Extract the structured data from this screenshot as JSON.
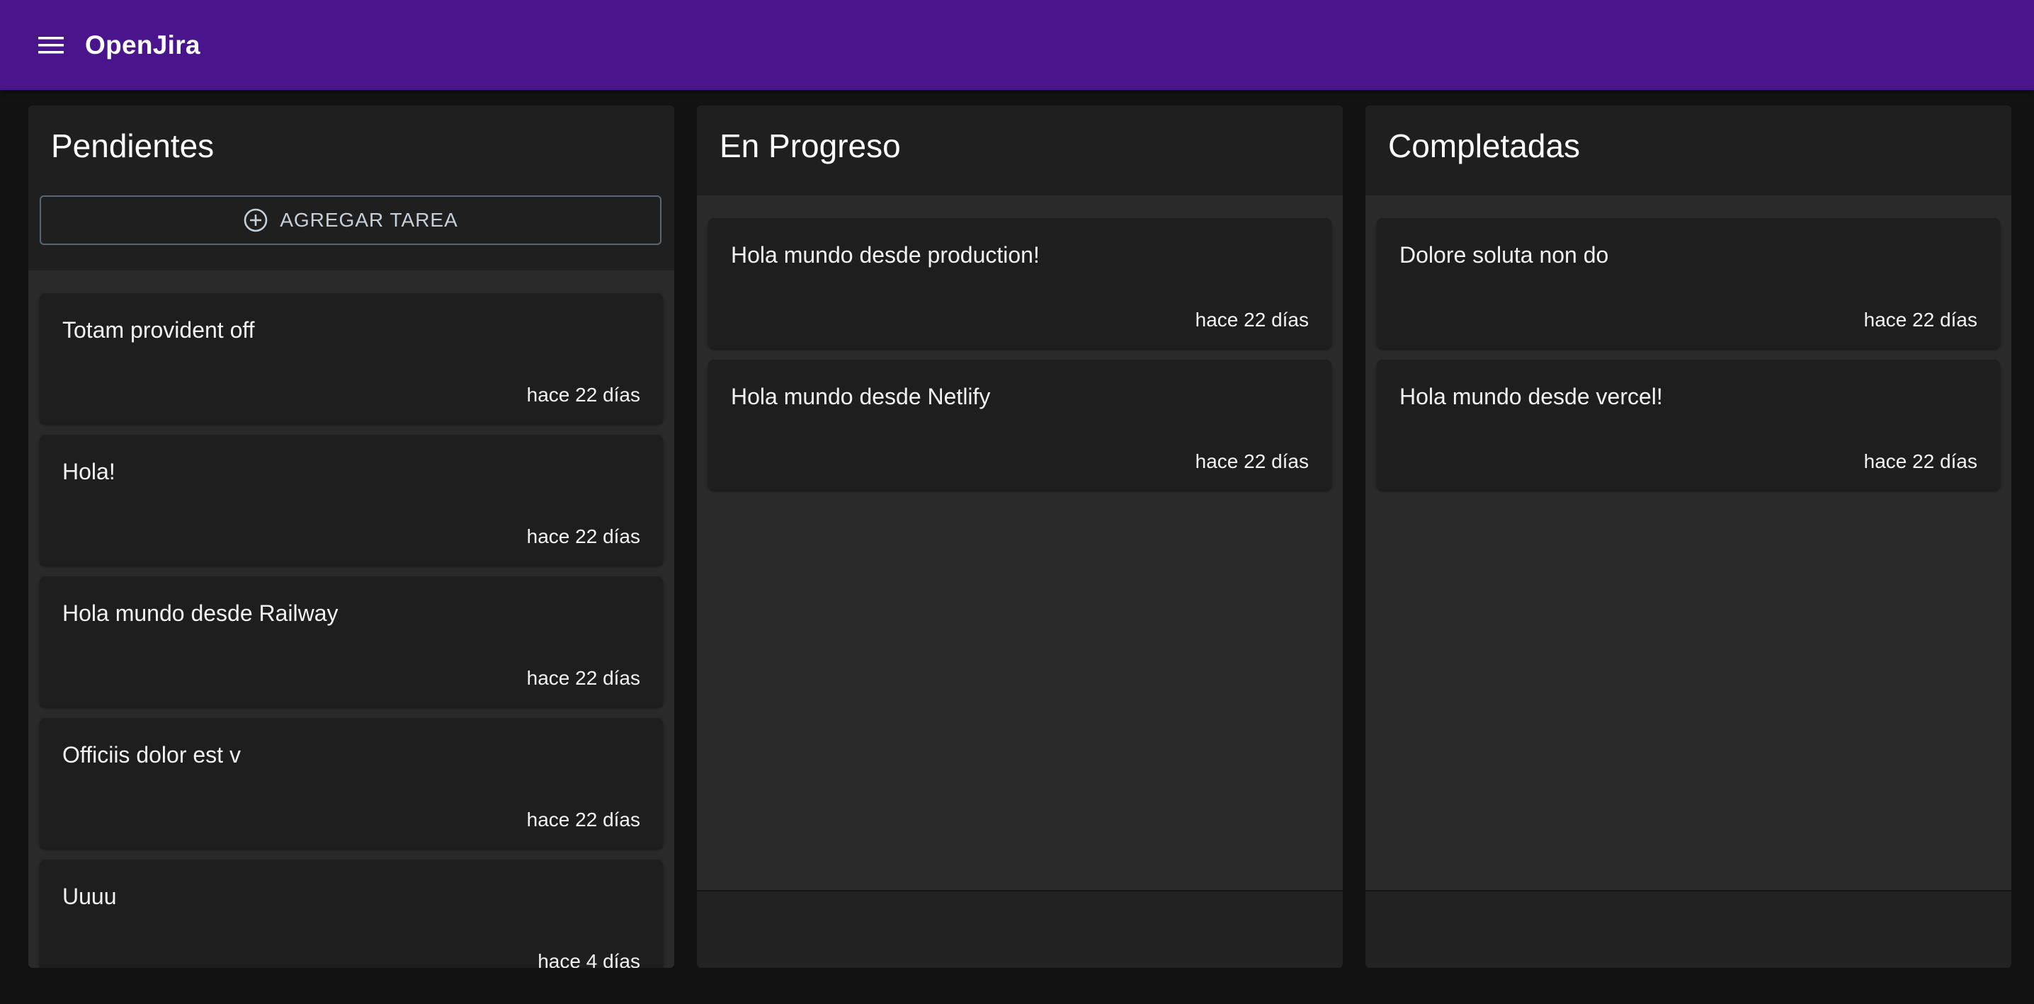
{
  "app": {
    "title": "OpenJira",
    "menu_icon": "menu-icon"
  },
  "colors": {
    "app_bar": "#4a148c",
    "background": "#121212",
    "column": "#1f1f1f",
    "list_area": "#2a2a2a",
    "card": "#1e1e1e"
  },
  "columns": [
    {
      "title": "Pendientes",
      "add_button_label": "AGREGAR TAREA",
      "add_button_icon": "add-circle-icon",
      "cards": [
        {
          "text": "Totam provident off",
          "time": "hace 22 días"
        },
        {
          "text": "Hola!",
          "time": "hace 22 días"
        },
        {
          "text": "Hola mundo desde Railway",
          "time": "hace 22 días"
        },
        {
          "text": "Officiis dolor est v",
          "time": "hace 22 días"
        },
        {
          "text": "Uuuu",
          "time": "hace 4 días"
        }
      ]
    },
    {
      "title": "En Progreso",
      "cards": [
        {
          "text": "Hola mundo desde production!",
          "time": "hace 22 días"
        },
        {
          "text": "Hola mundo desde Netlify",
          "time": "hace 22 días"
        }
      ]
    },
    {
      "title": "Completadas",
      "cards": [
        {
          "text": "Dolore soluta non do",
          "time": "hace 22 días"
        },
        {
          "text": "Hola mundo desde vercel!",
          "time": "hace 22 días"
        }
      ]
    }
  ]
}
